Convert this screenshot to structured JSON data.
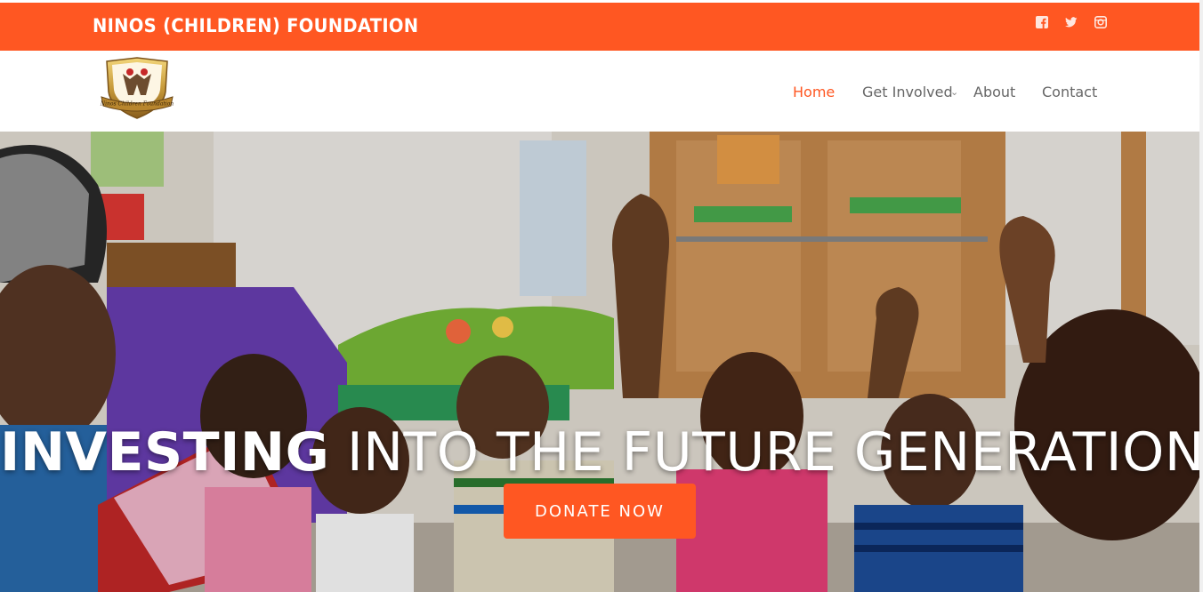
{
  "topbar": {
    "title": "NINOS (CHILDREN) FOUNDATION",
    "social_icons": [
      "facebook-icon",
      "twitter-icon",
      "instagram-icon"
    ],
    "background_color": "#ff5722"
  },
  "nav": {
    "items": [
      {
        "label": "Home",
        "active": true
      },
      {
        "label": "Get Involved",
        "has_dropdown": true
      },
      {
        "label": "About"
      },
      {
        "label": "Contact"
      }
    ],
    "accent_color": "#ff5722"
  },
  "hero": {
    "headline_bold": "INVESTING",
    "headline_rest": " INTO THE FUTURE GENERATION.",
    "cta_label": "DONATE NOW"
  }
}
